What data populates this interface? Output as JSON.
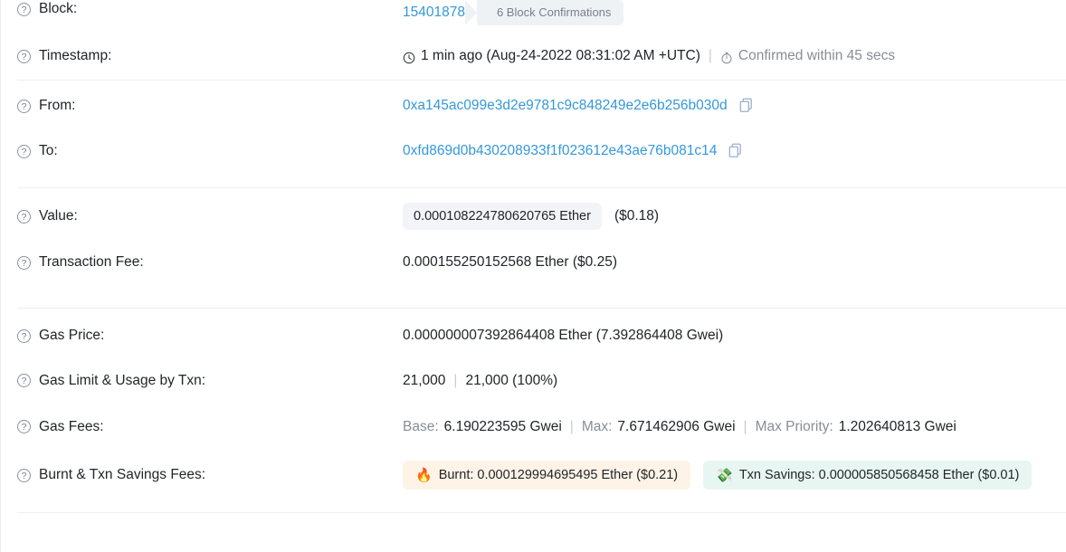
{
  "rows": {
    "block": {
      "label": "Block:",
      "help_icon": "question-circle-icon",
      "number": "15401878",
      "confirmations": "6 Block Confirmations"
    },
    "timestamp": {
      "label": "Timestamp:",
      "help_icon": "question-circle-icon",
      "clock_icon": "clock-icon",
      "relative": "1 min ago (Aug-24-2022 08:31:02 AM +UTC)",
      "separator": "|",
      "stopwatch_icon": "stopwatch-icon",
      "confirmed_within": "Confirmed within 45 secs"
    },
    "from": {
      "label": "From:",
      "help_icon": "question-circle-icon",
      "address": "0xa145ac099e3d2e9781c9c848249e2e6b256b030d",
      "copy_icon": "copy-icon"
    },
    "to": {
      "label": "To:",
      "help_icon": "question-circle-icon",
      "address": "0xfd869d0b430208933f1f023612e43ae76b081c14",
      "copy_icon": "copy-icon"
    },
    "value": {
      "label": "Value:",
      "help_icon": "question-circle-icon",
      "ether": "0.000108224780620765 Ether",
      "usd": "($0.18)"
    },
    "txn_fee": {
      "label": "Transaction Fee:",
      "help_icon": "question-circle-icon",
      "text": "0.000155250152568 Ether ($0.25)"
    },
    "gas_price": {
      "label": "Gas Price:",
      "help_icon": "question-circle-icon",
      "text": "0.000000007392864408 Ether (7.392864408 Gwei)"
    },
    "gas_limit": {
      "label": "Gas Limit & Usage by Txn:",
      "help_icon": "question-circle-icon",
      "limit": "21,000",
      "separator": "|",
      "usage": "21,000 (100%)"
    },
    "gas_fees": {
      "label": "Gas Fees:",
      "help_icon": "question-circle-icon",
      "base_label": "Base:",
      "base_value": "6.190223595 Gwei",
      "sep1": "|",
      "max_label": "Max:",
      "max_value": "7.671462906 Gwei",
      "sep2": "|",
      "max_priority_label": "Max Priority:",
      "max_priority_value": "1.202640813 Gwei"
    },
    "burnt_savings": {
      "label": "Burnt & Txn Savings Fees:",
      "help_icon": "question-circle-icon",
      "burnt_icon": "fire-icon",
      "burnt_text": "Burnt: 0.000129994695495 Ether ($0.21)",
      "savings_icon": "money-with-wings-icon",
      "savings_text": "Txn Savings: 0.000005850568458 Ether ($0.01)"
    }
  },
  "colors": {
    "link": "#3498db",
    "muted": "#868e96",
    "badge_bg": "#eff2f5",
    "chip_bg": "#f2f4f7",
    "burnt_bg": "#fdf3e6",
    "savings_bg": "#e8f6f1",
    "divider": "#edeff2"
  }
}
